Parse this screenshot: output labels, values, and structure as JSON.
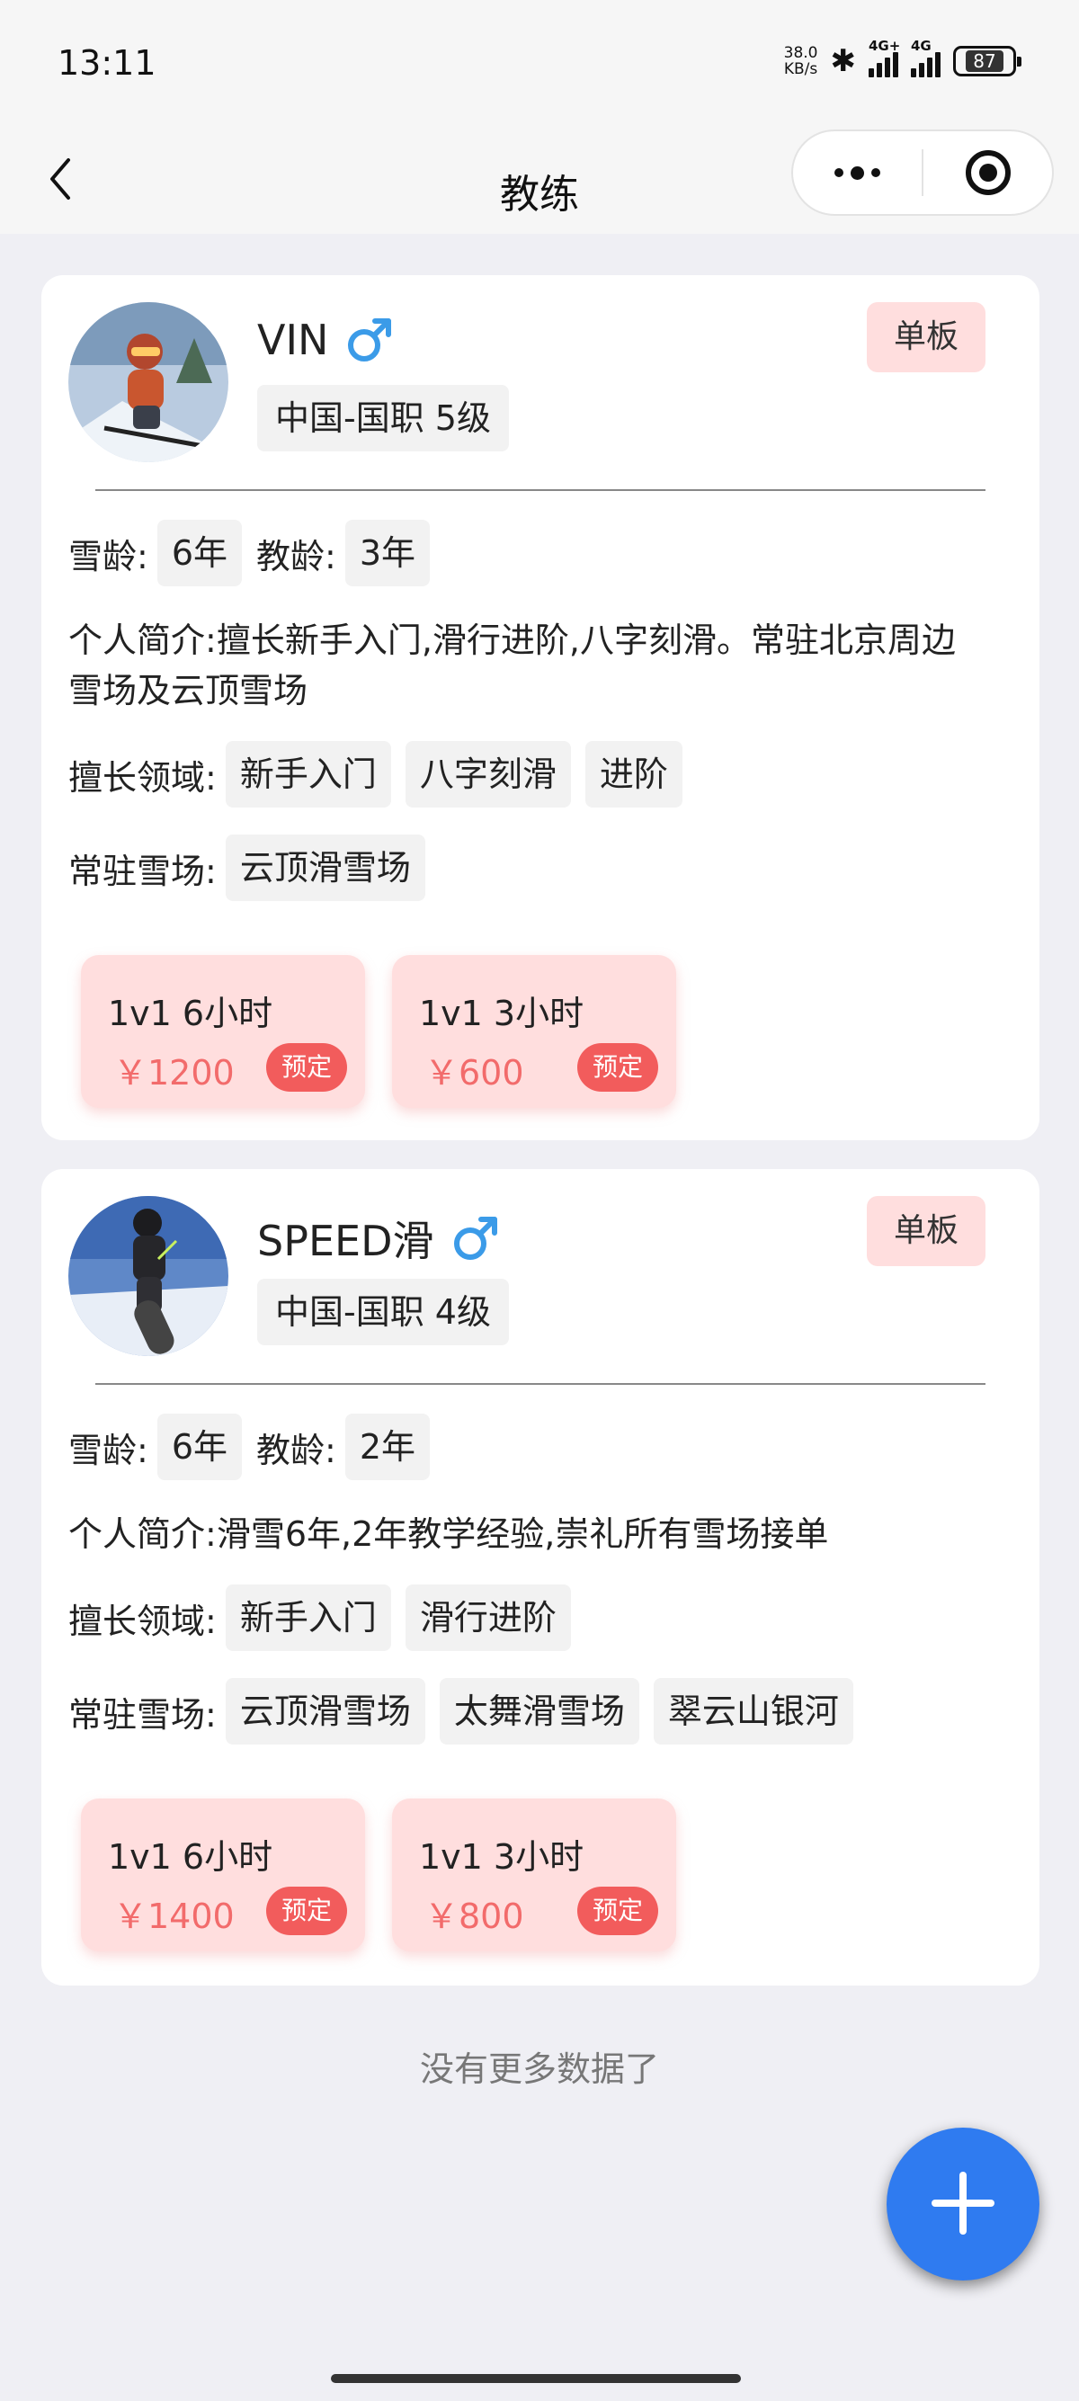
{
  "status_bar": {
    "time": "13:11",
    "net_speed_top": "38.0",
    "net_speed_unit": "KB/s",
    "signal1_label": "4G+",
    "signal2_label": "4G",
    "battery": "87"
  },
  "header": {
    "title": "教练"
  },
  "coaches": [
    {
      "name": "VIN",
      "gender_icon": "male-icon",
      "certification": "中国-国职 5级",
      "board_type": "单板",
      "snow_age_label": "雪龄:",
      "snow_age": "6年",
      "teach_age_label": "教龄:",
      "teach_age": "3年",
      "bio_label": "个人简介:",
      "bio": "擅长新手入门,滑行进阶,八字刻滑。常驻北京周边雪场及云顶雪场",
      "specialties_label": "擅长领域:",
      "specialties": [
        "新手入门",
        "八字刻滑",
        "进阶"
      ],
      "resorts_label": "常驻雪场:",
      "resorts": [
        "云顶滑雪场"
      ],
      "packages": [
        {
          "title": "1v1 6小时",
          "price": "￥1200",
          "action": "预定"
        },
        {
          "title": "1v1 3小时",
          "price": "￥600",
          "action": "预定"
        }
      ]
    },
    {
      "name": "SPEED滑",
      "gender_icon": "male-icon",
      "certification": "中国-国职 4级",
      "board_type": "单板",
      "snow_age_label": "雪龄:",
      "snow_age": "6年",
      "teach_age_label": "教龄:",
      "teach_age": "2年",
      "bio_label": "个人简介:",
      "bio": "滑雪6年,2年教学经验,崇礼所有雪场接单",
      "specialties_label": "擅长领域:",
      "specialties": [
        "新手入门",
        "滑行进阶"
      ],
      "resorts_label": "常驻雪场:",
      "resorts": [
        "云顶滑雪场",
        "太舞滑雪场",
        "翠云山银河"
      ],
      "packages": [
        {
          "title": "1v1 6小时",
          "price": "￥1400",
          "action": "预定"
        },
        {
          "title": "1v1 3小时",
          "price": "￥800",
          "action": "预定"
        }
      ]
    }
  ],
  "footer": {
    "no_more": "没有更多数据了"
  },
  "colors": {
    "accent_blue": "#2f7bf0",
    "gender_blue": "#3b9be8",
    "price_red": "#f26b6b",
    "book_red": "#f25c5c",
    "badge_pink": "#ffdede"
  }
}
